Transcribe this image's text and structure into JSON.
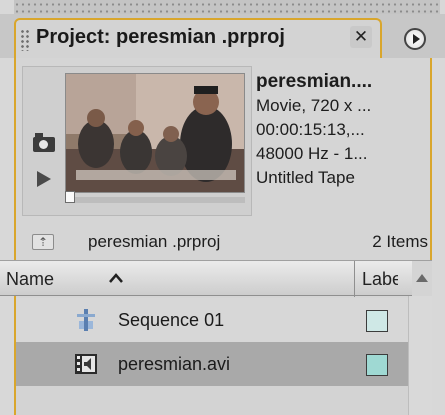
{
  "panel": {
    "tab_title": "Project: peresmian .prproj",
    "close_glyph": "✕",
    "accent_color": "#d9a62c"
  },
  "clip_info": {
    "name": "peresmian....",
    "type": "Movie, 720 x ...",
    "duration": "00:00:15:13,...",
    "audio": "48000 Hz - 1...",
    "tape": "Untitled Tape"
  },
  "path_bar": {
    "path": "peresmian .prproj",
    "items": "2 Items",
    "up_glyph": "⇡"
  },
  "columns": {
    "name": "Name",
    "label": "Label"
  },
  "rows": [
    {
      "name": "Sequence 01",
      "icon": "sequence-icon",
      "label_color": "#cfe8e6"
    },
    {
      "name": "peresmian.avi",
      "icon": "audio-video-clip-icon",
      "label_color": "#9fd9d3"
    }
  ]
}
